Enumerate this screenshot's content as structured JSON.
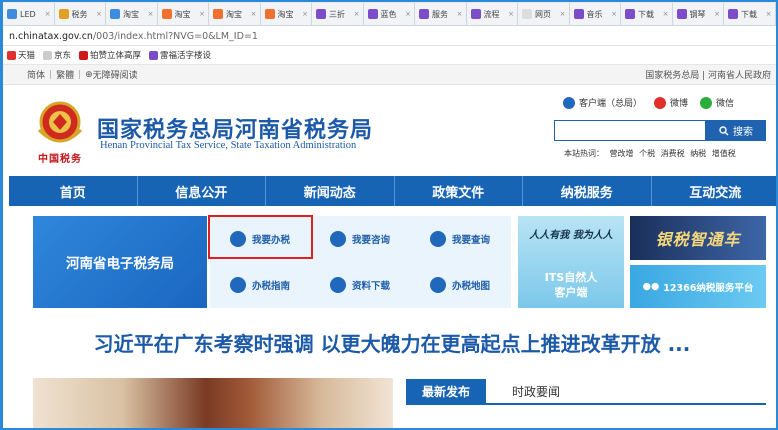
{
  "browser_tabs": [
    {
      "title": "LED",
      "color": "#3c8de0"
    },
    {
      "title": "税务",
      "color": "#e0a020"
    },
    {
      "title": "淘宝",
      "color": "#3c8de0"
    },
    {
      "title": "淘宝",
      "color": "#f07030"
    },
    {
      "title": "淘宝",
      "color": "#f07030"
    },
    {
      "title": "淘宝",
      "color": "#f07030"
    },
    {
      "title": "三折",
      "color": "#7b4dc8"
    },
    {
      "title": "蓝色",
      "color": "#7b4dc8"
    },
    {
      "title": "服务",
      "color": "#7b4dc8"
    },
    {
      "title": "流程",
      "color": "#7b4dc8"
    },
    {
      "title": "网页",
      "color": "#dddddd"
    },
    {
      "title": "音乐",
      "color": "#7b4dc8"
    },
    {
      "title": "下载",
      "color": "#7b4dc8"
    },
    {
      "title": "钢琴",
      "color": "#7b4dc8"
    },
    {
      "title": "下载",
      "color": "#7b4dc8"
    }
  ],
  "address": {
    "host": "n.chinatax.gov.cn",
    "path": "/003/index.html?NVG=0&LM_ID=1"
  },
  "bookmarks": [
    {
      "label": "天猫",
      "color": "#e03030"
    },
    {
      "label": "京东",
      "color": "#cccccc"
    },
    {
      "label": "铂赞立体高厚",
      "color": "#d01818"
    },
    {
      "label": "雷福活字楼设",
      "color": "#7b4dc8"
    }
  ],
  "util": {
    "simplified": "简体",
    "traditional": "繁體",
    "accessible": "无障碍阅读",
    "links": "国家税务总局 | 河南省人民政府"
  },
  "site": {
    "emblem_script": "中国税务",
    "title_cn": "国家税务总局河南省税务局",
    "title_en": "Henan Provincial Tax Service, State Taxation Administration"
  },
  "quicklinks": [
    {
      "label": "客户端（总局）",
      "color": "#1f68bc"
    },
    {
      "label": "微博",
      "color": "#e0302a"
    },
    {
      "label": "微信",
      "color": "#2aae3a"
    }
  ],
  "search": {
    "button_label": "搜索",
    "hot_label": "本站热词：",
    "hot_words": [
      "营改增",
      "个税",
      "消费税",
      "纳税",
      "增值税"
    ]
  },
  "nav": [
    "首页",
    "信息公开",
    "新闻动态",
    "政策文件",
    "纳税服务",
    "互动交流"
  ],
  "services": {
    "etax_label": "河南省电子税务局",
    "items": [
      {
        "label": "我要办税",
        "icon": "tax-handling-icon"
      },
      {
        "label": "我要咨询",
        "icon": "consult-icon"
      },
      {
        "label": "我要查询",
        "icon": "query-icon"
      },
      {
        "label": "办税指南",
        "icon": "guide-icon"
      },
      {
        "label": "资料下载",
        "icon": "download-icon"
      },
      {
        "label": "办税地图",
        "icon": "map-pin-icon"
      }
    ]
  },
  "its": {
    "script": "人人有我 我为人人",
    "label_line1": "ITS自然人",
    "label_line2": "客户端"
  },
  "banners": {
    "banner1": "银税智通车",
    "banner2": "12366纳税服务平台"
  },
  "headline": "习近平在广东考察时强调 以更大魄力在更高起点上推进改革开放 ...",
  "news_tabs": {
    "active": "最新发布",
    "inactive": "时政要闻"
  }
}
